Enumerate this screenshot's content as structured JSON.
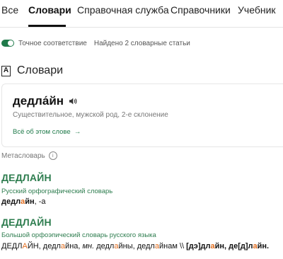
{
  "tabs": [
    {
      "label": "Все"
    },
    {
      "label": "Словари"
    },
    {
      "label": "Справочная служба"
    },
    {
      "label": "Справочники"
    },
    {
      "label": "Учебник"
    }
  ],
  "filter": {
    "exact_match_label": "Точное соответствие",
    "exact_match_on": true,
    "found_text": "Найдено 2 словарные статьи"
  },
  "section": {
    "icon_letter": "A",
    "title": "Словари"
  },
  "card": {
    "word_pre": "дедл",
    "word_acc": "а́",
    "word_post": "йн",
    "grammar": "Существительное, мужской род, 2-е склонение",
    "all_link": "Всё об этом слове",
    "all_link_arrow": "→"
  },
  "meta": {
    "label": "Метасловарь",
    "info_icon": "i"
  },
  "entries": [
    {
      "headword": "ДЕДЛАЙН",
      "source": "Русский орфографический словарь",
      "t_pre": "дедл",
      "t_acc": "а",
      "t_post": "йн",
      "t_suffix": ", -а"
    },
    {
      "headword": "ДЕДЛАЙН",
      "source": "Большой орфоэпический словарь русского языка",
      "p1_pre": "ДЕДЛ",
      "p1_acc": "А",
      "p1_post": "ЙН, ",
      "p2_pre": "дедл",
      "p2_acc": "а",
      "p2_post": "йна, ",
      "p3_abbr": "мн.",
      "p4_pre": " дедл",
      "p4_acc": "а",
      "p4_post": "йны, ",
      "p5_pre": "дедл",
      "p5_acc": "а",
      "p5_post": "йнам \\\\ ",
      "p6_pre": "[дэ]дл",
      "p6_acc": "а",
      "p6_post": "йн, де[д]л",
      "p7_acc": "а",
      "p7_post": "йн."
    }
  ],
  "colors": {
    "accent_green": "#2e7d4f",
    "stress_orange": "#e06d1f"
  },
  "icons": {
    "speaker": "speaker-icon",
    "dictionary": "dictionary-icon",
    "info": "info-icon"
  }
}
